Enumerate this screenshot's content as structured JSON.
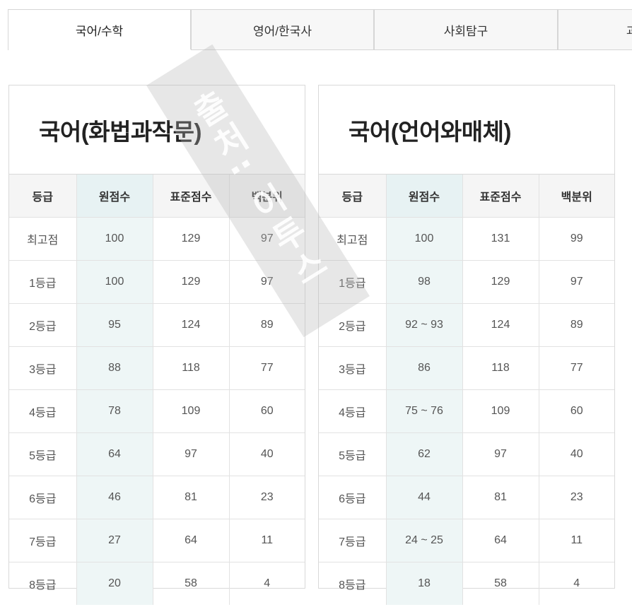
{
  "tabs": [
    {
      "label": "국어/수학",
      "active": true
    },
    {
      "label": "영어/한국사",
      "active": false
    },
    {
      "label": "사회탐구",
      "active": false
    },
    {
      "label": "과",
      "active": false
    }
  ],
  "columns": [
    "등급",
    "원점수",
    "표준점수",
    "백분위"
  ],
  "panels": [
    {
      "title": "국어(화법과작문)",
      "rows": [
        [
          "최고점",
          "100",
          "129",
          "97"
        ],
        [
          "1등급",
          "100",
          "129",
          "97"
        ],
        [
          "2등급",
          "95",
          "124",
          "89"
        ],
        [
          "3등급",
          "88",
          "118",
          "77"
        ],
        [
          "4등급",
          "78",
          "109",
          "60"
        ],
        [
          "5등급",
          "64",
          "97",
          "40"
        ],
        [
          "6등급",
          "46",
          "81",
          "23"
        ],
        [
          "7등급",
          "27",
          "64",
          "11"
        ],
        [
          "8등급",
          "20",
          "58",
          "4"
        ]
      ]
    },
    {
      "title": "국어(언어와매체)",
      "rows": [
        [
          "최고점",
          "100",
          "131",
          "99"
        ],
        [
          "1등급",
          "98",
          "129",
          "97"
        ],
        [
          "2등급",
          "92 ~ 93",
          "124",
          "89"
        ],
        [
          "3등급",
          "86",
          "118",
          "77"
        ],
        [
          "4등급",
          "75 ~ 76",
          "109",
          "60"
        ],
        [
          "5등급",
          "62",
          "97",
          "40"
        ],
        [
          "6등급",
          "44",
          "81",
          "23"
        ],
        [
          "7등급",
          "24 ~ 25",
          "64",
          "11"
        ],
        [
          "8등급",
          "18",
          "58",
          "4"
        ]
      ]
    }
  ],
  "watermark": "출처: 이투스",
  "colors": {
    "raw_column_bg": "#eef6f6",
    "header_bg": "#f5f5f5",
    "border": "#d9d9d9"
  }
}
